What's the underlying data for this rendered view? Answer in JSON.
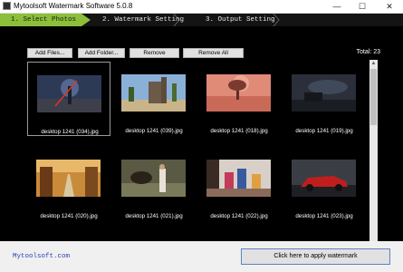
{
  "window": {
    "title": "Mytoolsoft Watermark Software 5.0.8",
    "minimize_glyph": "—",
    "maximize_glyph": "☐",
    "close_glyph": "✕"
  },
  "steps": [
    {
      "label": "1. Select Photos",
      "active": true
    },
    {
      "label": "2. Watermark Setting",
      "active": false
    },
    {
      "label": "3. Output Setting",
      "active": false
    }
  ],
  "toolbar": {
    "add_files_label": "Add Files...",
    "add_folder_label": "Add Folder...",
    "remove_label": "Remove",
    "remove_all_label": "Remove All",
    "total_label": "Total: 23"
  },
  "photos": [
    {
      "name": "desktop 1241 (034).jpg",
      "selected": true,
      "icon": "warrior-photo"
    },
    {
      "name": "desktop 1241 (039).jpg",
      "selected": false,
      "icon": "castle-photo"
    },
    {
      "name": "desktop 1241 (018).jpg",
      "selected": false,
      "icon": "tree-sunset-photo"
    },
    {
      "name": "desktop 1241 (019).jpg",
      "selected": false,
      "icon": "dark-sky-photo"
    },
    {
      "name": "desktop 1241 (020).jpg",
      "selected": false,
      "icon": "autumn-road-photo"
    },
    {
      "name": "desktop 1241 (021).jpg",
      "selected": false,
      "icon": "girl-horse-photo"
    },
    {
      "name": "desktop 1241 (022).jpg",
      "selected": false,
      "icon": "party-photo"
    },
    {
      "name": "desktop 1241 (023).jpg",
      "selected": false,
      "icon": "red-car-photo"
    }
  ],
  "scrollbar": {
    "up_glyph": "▲",
    "down_glyph": "▼"
  },
  "footer": {
    "site_link": "Mytoolsoft.com",
    "apply_label": "Click here to apply watermark"
  },
  "colors": {
    "step_active": "#8cbf3a",
    "step_bar": "#141414",
    "main_bg": "#000000",
    "link": "#2a3fb5"
  }
}
